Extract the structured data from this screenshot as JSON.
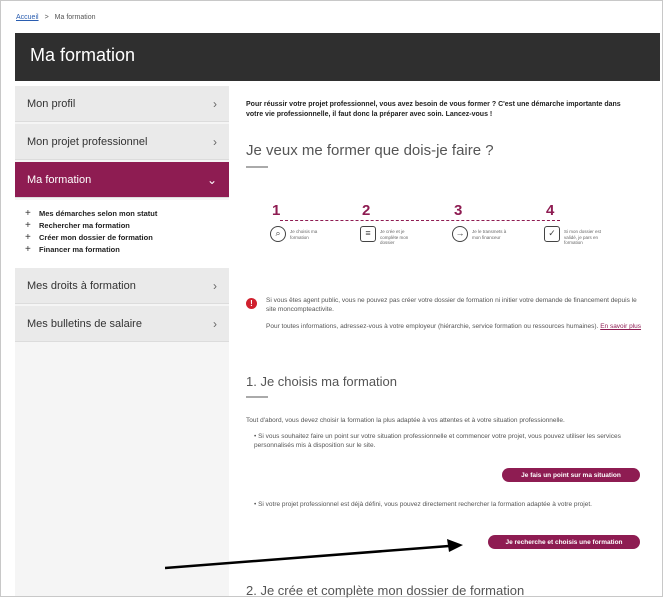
{
  "breadcrumb": {
    "home": "Accueil",
    "separator": ">",
    "current": "Ma formation"
  },
  "header": {
    "title": "Ma formation"
  },
  "sidebar": {
    "items": [
      {
        "label": "Mon profil"
      },
      {
        "label": "Mon projet professionnel"
      },
      {
        "label": "Ma formation"
      },
      {
        "label": "Mes droits à formation"
      },
      {
        "label": "Mes bulletins de salaire"
      }
    ],
    "subitems": [
      {
        "label": "Mes démarches selon mon statut"
      },
      {
        "label": "Rechercher ma formation"
      },
      {
        "label": "Créer mon dossier de formation"
      },
      {
        "label": "Financer ma formation"
      }
    ]
  },
  "main": {
    "intro": "Pour réussir votre projet professionnel, vous avez besoin de vous former ? C'est une démarche importante dans votre vie professionnelle, il faut donc la préparer avec soin. Lancez-vous !",
    "heading": "Je veux me former que dois-je faire ?",
    "steps": [
      {
        "num": "1",
        "text": "Je choisis ma formation"
      },
      {
        "num": "2",
        "text": "Je crée et je complète mon dossier"
      },
      {
        "num": "3",
        "text": "Je le transmets à mon financeur"
      },
      {
        "num": "4",
        "text": "Si mon dossier est validé, je pars en formation"
      }
    ],
    "warning": {
      "text1": "Si vous êtes agent public, vous ne pouvez pas créer votre dossier de formation ni initier votre demande de financement depuis le site moncompteactivite.",
      "text2": "Pour toutes informations, adressez-vous à votre employeur (hiérarchie, service formation ou ressources humaines).",
      "link": "En savoir plus"
    },
    "section1": {
      "title": "1. Je choisis ma formation",
      "paragraph": "Tout d'abord, vous devez choisir la formation la plus adaptée à vos attentes et à votre situation professionnelle.",
      "bullet1": "Si vous souhaitez faire un point sur votre situation professionnelle et commencer votre projet, vous pouvez utiliser les services personnalisés mis à disposition sur le site.",
      "button1": "Je fais un point sur ma situation",
      "bullet2": "Si votre projet professionnel est déjà défini, vous pouvez directement rechercher la formation adaptée à votre projet.",
      "button2": "Je recherche et choisis une formation"
    },
    "section2": {
      "title": "2. Je crée et complète mon dossier de formation"
    }
  },
  "colors": {
    "accent": "#8e1c52",
    "header": "#2f2f2f",
    "warning": "#d0202e"
  }
}
